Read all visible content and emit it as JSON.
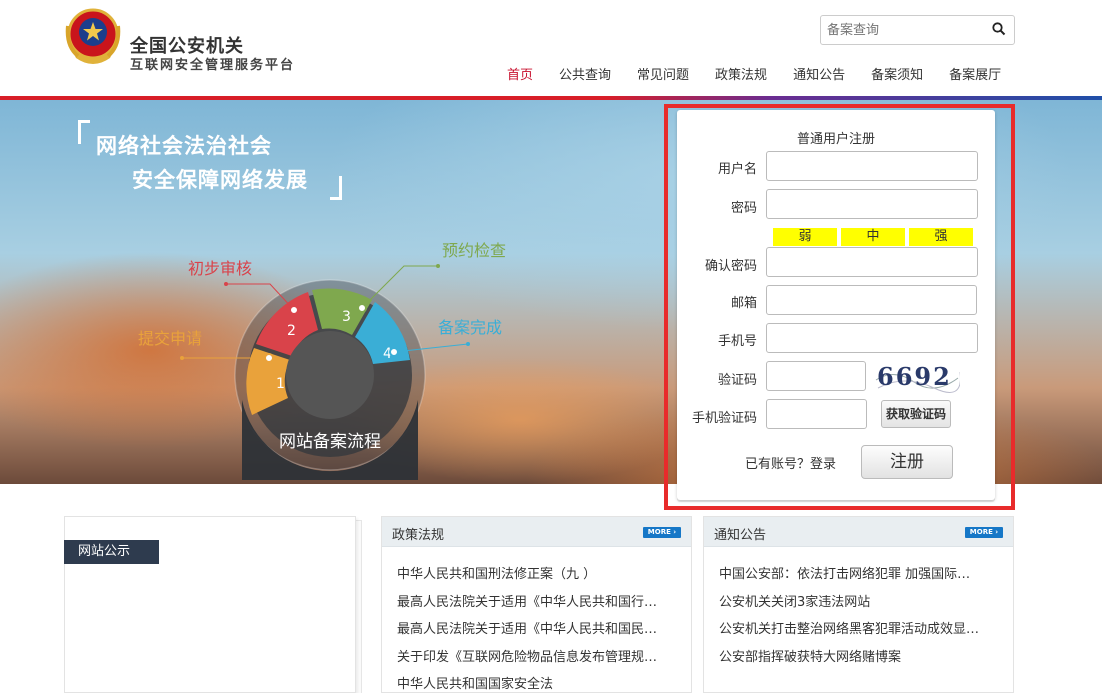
{
  "header": {
    "org_name": "全国公安机关",
    "platform_name": "互联网安全管理服务平台",
    "search_placeholder": "备案查询"
  },
  "nav": {
    "items": [
      "首页",
      "公共查询",
      "常见问题",
      "政策法规",
      "通知公告",
      "备案须知",
      "备案展厅"
    ],
    "active_index": 0
  },
  "banner": {
    "slogan_line1": "网络社会法治社会",
    "slogan_line2": "安全保障网络发展",
    "flow_center": "网站备案流程",
    "steps": [
      {
        "num": "1",
        "label": "提交申请",
        "color": "#e9a23b"
      },
      {
        "num": "2",
        "label": "初步审核",
        "color": "#d9434a"
      },
      {
        "num": "3",
        "label": "预约检查",
        "color": "#7fa84e"
      },
      {
        "num": "4",
        "label": "备案完成",
        "color": "#3aaed6"
      }
    ]
  },
  "register": {
    "title": "普通用户注册",
    "labels": {
      "username": "用户名",
      "password": "密码",
      "confirm": "确认密码",
      "email": "邮箱",
      "phone": "手机号",
      "captcha": "验证码",
      "sms_code": "手机验证码"
    },
    "strength": [
      "弱",
      "中",
      "强"
    ],
    "captcha_text": "6692",
    "sms_button": "获取验证码",
    "login_link": "已有账号？登录",
    "submit_button": "注册"
  },
  "notice": {
    "tag": "网站公示"
  },
  "policy": {
    "title": "政策法规",
    "more": "MORE",
    "items": [
      "中华人民共和国刑法修正案（九 ）",
      "最高人民法院关于适用《中华人民共和国行…",
      "最高人民法院关于适用《中华人民共和国民…",
      "关于印发《互联网危险物品信息发布管理规…",
      "中华人民共和国国家安全法"
    ]
  },
  "announcements": {
    "title": "通知公告",
    "more": "MORE",
    "items": [
      "中国公安部：依法打击网络犯罪 加强国际…",
      "公安机关关闭3家违法网站",
      "公安机关打击整治网络黑客犯罪活动成效显…",
      "公安部指挥破获特大网络赌博案"
    ]
  },
  "colors": {
    "brand_red": "#c8102e",
    "highlight_outline": "#e82b2b",
    "strength_yellow": "#ffff00",
    "notice_tag_bg": "#2e3b4e",
    "more_badge": "#1677c7"
  }
}
